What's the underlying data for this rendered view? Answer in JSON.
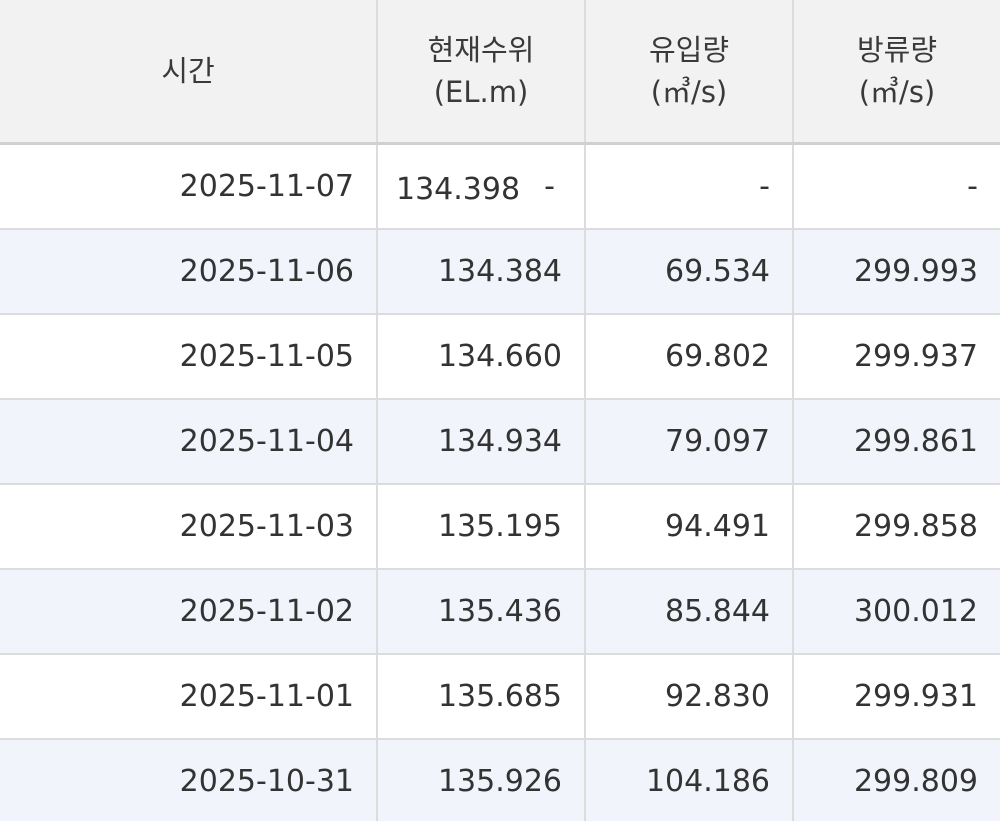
{
  "table": {
    "headers": {
      "time": "시간",
      "level_line1": "현재수위",
      "level_line2": "(EL.m)",
      "inflow_line1": "유입량",
      "inflow_line2": "(㎥/s)",
      "outflow_line1": "방류량",
      "outflow_line2": "(㎥/s)"
    },
    "rows": [
      {
        "time": "2025-11-07",
        "level": "134.398",
        "level_extra": "-",
        "inflow": "-",
        "outflow": "-"
      },
      {
        "time": "2025-11-06",
        "level": "134.384",
        "inflow": "69.534",
        "outflow": "299.993"
      },
      {
        "time": "2025-11-05",
        "level": "134.660",
        "inflow": "69.802",
        "outflow": "299.937"
      },
      {
        "time": "2025-11-04",
        "level": "134.934",
        "inflow": "79.097",
        "outflow": "299.861"
      },
      {
        "time": "2025-11-03",
        "level": "135.195",
        "inflow": "94.491",
        "outflow": "299.858"
      },
      {
        "time": "2025-11-02",
        "level": "135.436",
        "inflow": "85.844",
        "outflow": "300.012"
      },
      {
        "time": "2025-11-01",
        "level": "135.685",
        "inflow": "92.830",
        "outflow": "299.931"
      },
      {
        "time": "2025-10-31",
        "level": "135.926",
        "inflow": "104.186",
        "outflow": "299.809"
      }
    ]
  },
  "colors": {
    "header_bg": "#f2f2f2",
    "stripe_bg": "#f1f5fb",
    "border": "#dcdcdc",
    "text": "#333333"
  }
}
